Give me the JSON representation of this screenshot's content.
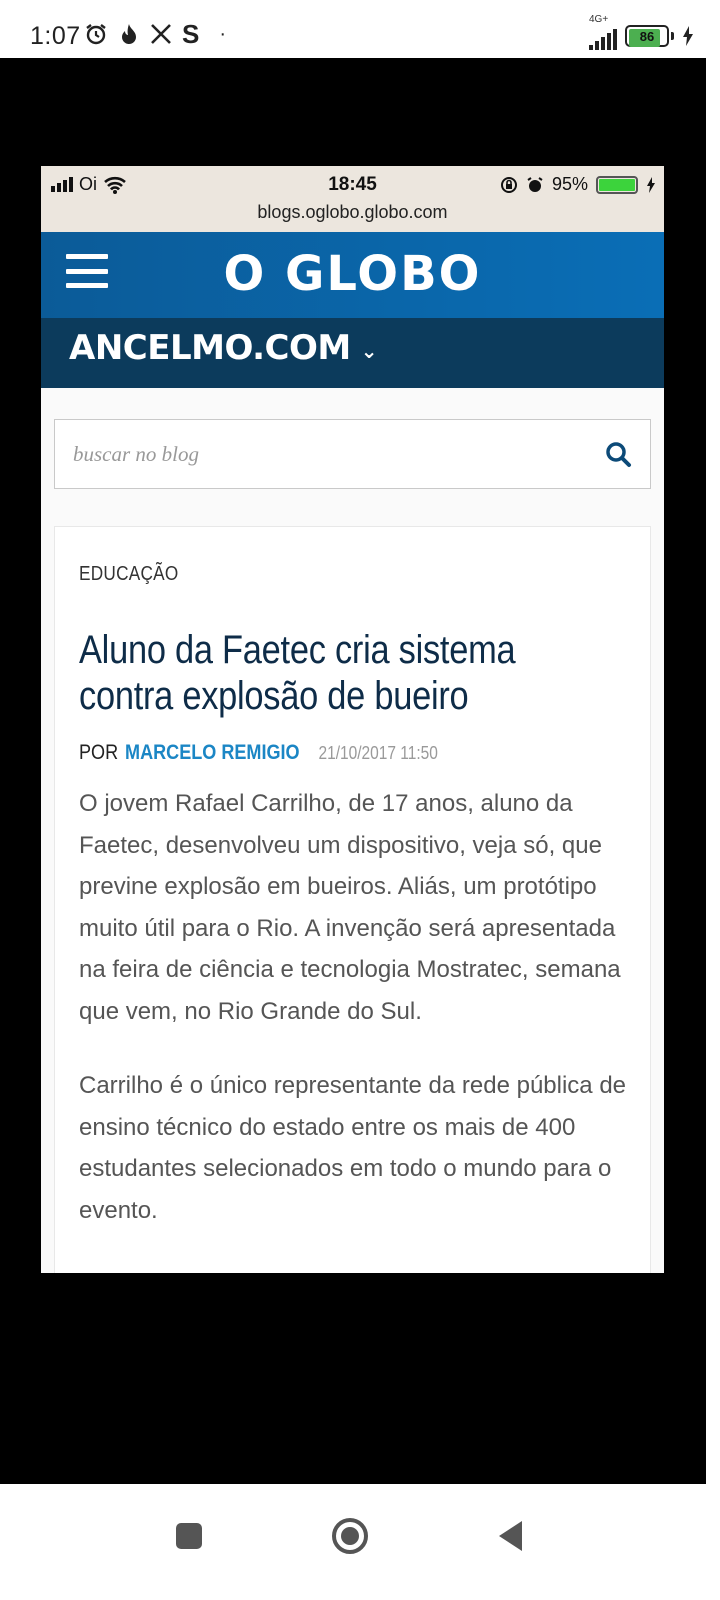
{
  "android_status": {
    "time": "1:07",
    "network": "4G+",
    "battery": "86",
    "battery_level": 0.86,
    "icons": [
      "alarm-icon",
      "flame-icon",
      "x-icon",
      "s-icon",
      "dot-icon"
    ]
  },
  "inner_status": {
    "carrier": "Oi",
    "time": "18:45",
    "url": "blogs.oglobo.globo.com",
    "battery": "95%",
    "battery_level": 0.95
  },
  "header": {
    "logo": "O GLOBO",
    "blog_name": "ANCELMO.COM",
    "chevron": "⌄"
  },
  "search": {
    "placeholder": "buscar no blog",
    "value": ""
  },
  "article": {
    "category": "EDUCAÇÃO",
    "title": "Aluno da Faetec cria sistema contra explosão de bueiro",
    "by_prefix": "POR",
    "author": "MARCELO REMIGIO",
    "date": "21/10/2017 11:50",
    "paragraphs": [
      "O jovem Rafael Carrilho, de 17 anos, aluno da Faetec, desenvolveu um dispositivo, veja só, que previne explosão em bueiros. Aliás, um protótipo muito útil para o Rio. A invenção será apresentada na feira de ciência e tecnologia Mostratec, semana que vem, no Rio Grande do Sul.",
      "Carrilho é o único representante da rede pública de ensino técnico do estado entre os mais de 400 estudantes selecionados em todo o mundo para o evento."
    ]
  },
  "colors": {
    "header_blue": "#0a6eb6",
    "blog_bar": "#0c3b5c",
    "headline": "#0e2c48",
    "author": "#1b86c5"
  }
}
